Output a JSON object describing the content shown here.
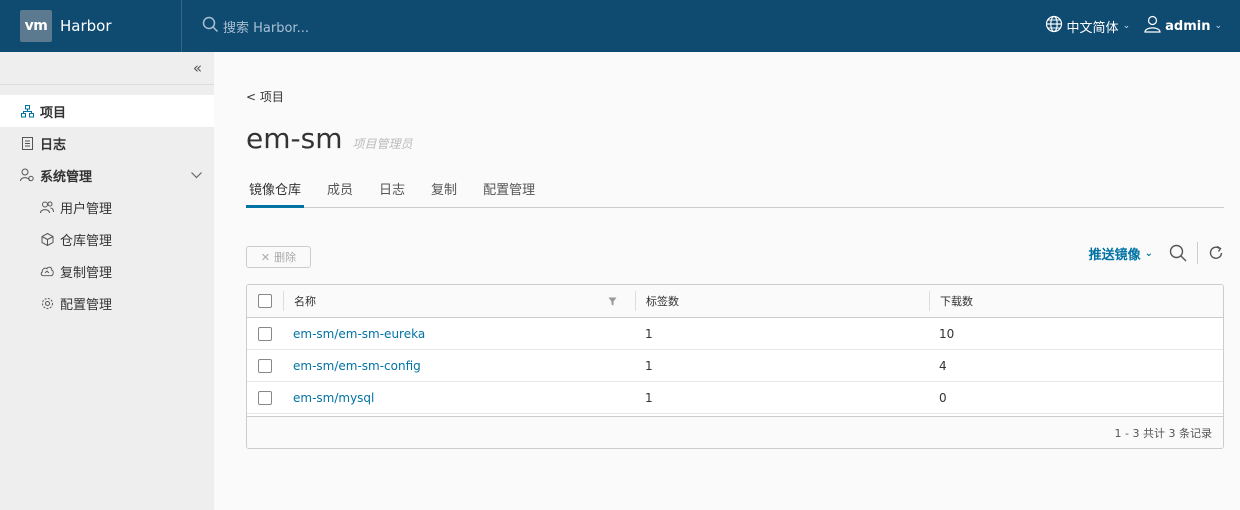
{
  "header": {
    "logo_text": "vm",
    "app_name": "Harbor",
    "search_placeholder": "搜索 Harbor...",
    "language": "中文简体",
    "user": "admin"
  },
  "sidebar": {
    "items": [
      {
        "label": "项目",
        "icon": "projects-icon",
        "active": true
      },
      {
        "label": "日志",
        "icon": "logs-icon",
        "active": false
      },
      {
        "label": "系统管理",
        "icon": "admin-icon",
        "active": false,
        "expanded": true
      }
    ],
    "sub_items": [
      {
        "label": "用户管理",
        "icon": "users-icon"
      },
      {
        "label": "仓库管理",
        "icon": "registry-icon"
      },
      {
        "label": "复制管理",
        "icon": "replication-icon"
      },
      {
        "label": "配置管理",
        "icon": "config-icon"
      }
    ]
  },
  "main": {
    "back_link": "< 项目",
    "project_name": "em-sm",
    "role": "项目管理员",
    "tabs": [
      {
        "label": "镜像仓库",
        "active": true
      },
      {
        "label": "成员",
        "active": false
      },
      {
        "label": "日志",
        "active": false
      },
      {
        "label": "复制",
        "active": false
      },
      {
        "label": "配置管理",
        "active": false
      }
    ],
    "delete_label": "删除",
    "push_label": "推送镜像",
    "table": {
      "columns": [
        "名称",
        "标签数",
        "下载数"
      ],
      "rows": [
        {
          "name": "em-sm/em-sm-eureka",
          "tags": "1",
          "pulls": "10"
        },
        {
          "name": "em-sm/em-sm-config",
          "tags": "1",
          "pulls": "4"
        },
        {
          "name": "em-sm/mysql",
          "tags": "1",
          "pulls": "0"
        }
      ],
      "footer": "1 - 3 共计 3 条记录"
    }
  },
  "colors": {
    "header_bg": "#0f4a71",
    "accent": "#0072a3",
    "sidebar_bg": "#eeeeee"
  }
}
